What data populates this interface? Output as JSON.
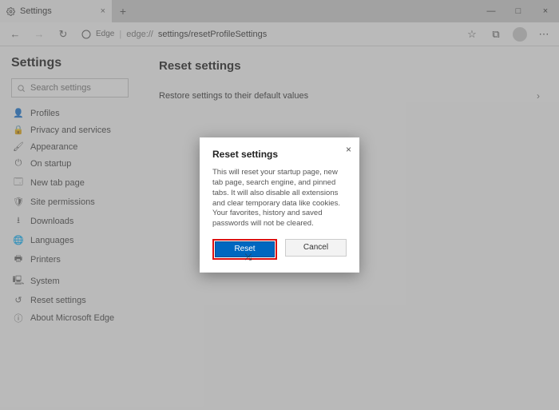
{
  "window": {
    "tab_title": "Settings",
    "min": "—",
    "max": "□",
    "close": "×",
    "newtab": "+"
  },
  "toolbar": {
    "back": "←",
    "forward": "→",
    "refresh": "↻",
    "edge_label": "Edge",
    "url_scheme": "edge://",
    "url_path": "settings/resetProfileSettings",
    "star": "☆",
    "ext": "⧉",
    "menu": "⋯"
  },
  "sidebar": {
    "title": "Settings",
    "search_placeholder": "Search settings",
    "items": [
      {
        "icon": "👤",
        "label": "Profiles"
      },
      {
        "icon": "🔒",
        "label": "Privacy and services"
      },
      {
        "icon": "🖌",
        "label": "Appearance"
      },
      {
        "icon": "⏻",
        "label": "On startup"
      },
      {
        "icon": "🗔",
        "label": "New tab page"
      },
      {
        "icon": "🛡",
        "label": "Site permissions"
      },
      {
        "icon": "⭳",
        "label": "Downloads"
      },
      {
        "icon": "🌐",
        "label": "Languages"
      },
      {
        "icon": "🖶",
        "label": "Printers"
      },
      {
        "icon": "🖳",
        "label": "System"
      },
      {
        "icon": "↺",
        "label": "Reset settings"
      },
      {
        "icon": "ⓘ",
        "label": "About Microsoft Edge"
      }
    ]
  },
  "main": {
    "title": "Reset settings",
    "row_label": "Restore settings to their default values",
    "chevron": "›"
  },
  "dialog": {
    "title": "Reset settings",
    "close": "×",
    "body": "This will reset your startup page, new tab page, search engine, and pinned tabs. It will also disable all extensions and clear temporary data like cookies. Your favorites, history and saved passwords will not be cleared.",
    "reset": "Reset",
    "cancel": "Cancel"
  }
}
